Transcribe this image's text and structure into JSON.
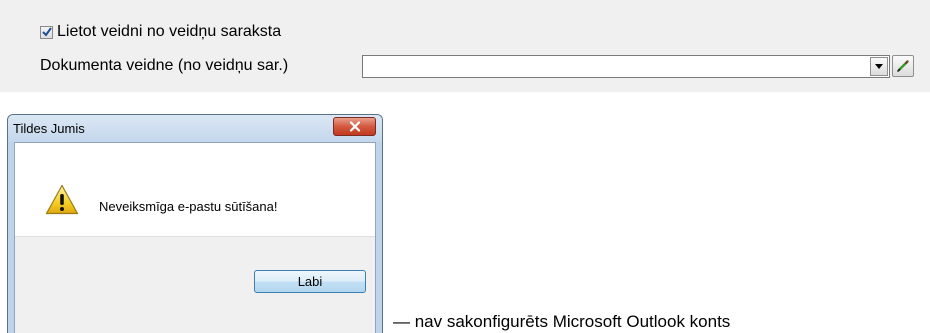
{
  "form": {
    "checkbox_label": "Lietot veidni no veidņu saraksta",
    "checkbox_checked": true,
    "template_label": "Dokumenta veidne (no veidņu sar.)",
    "template_value": ""
  },
  "dialog": {
    "title": "Tildes Jumis",
    "message": "Neveiksmīga e-pastu sūtīšana!",
    "ok_label": "Labi",
    "icon": "warning-icon"
  },
  "caption": "— nav sakonfigurēts Microsoft Outlook konts"
}
